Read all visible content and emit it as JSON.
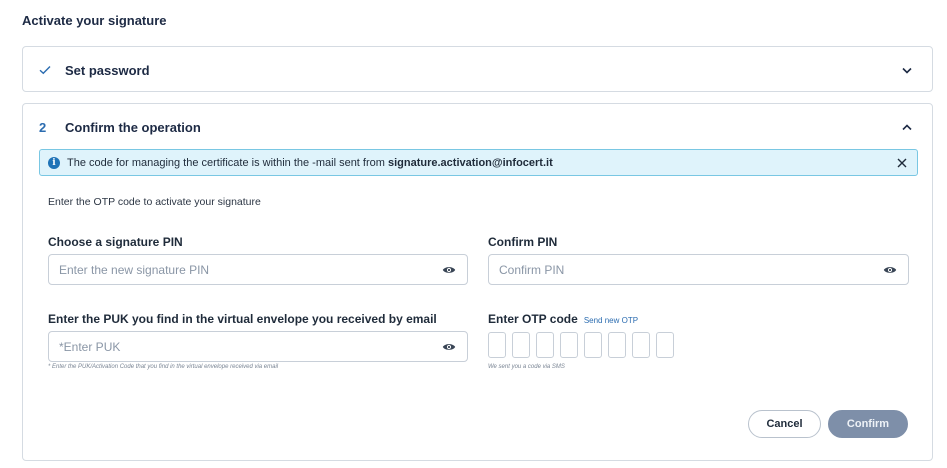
{
  "page_title": "Activate your signature",
  "step1": {
    "title": "Set password",
    "status_icon": "check-icon",
    "toggle_icon": "chevron-down-icon"
  },
  "step2": {
    "number": "2",
    "title": "Confirm the operation",
    "toggle_icon": "chevron-up-icon",
    "alert": {
      "text": "The code for managing the certificate is within the -mail sent from ",
      "email": "signature.activation@infocert.it",
      "icon": "info-icon"
    },
    "intro": "Enter the OTP code to activate your signature",
    "pin": {
      "label": "Choose a signature PIN",
      "placeholder": "Enter the new signature PIN",
      "value": ""
    },
    "confirm_pin": {
      "label": "Confirm PIN",
      "placeholder": "Confirm PIN",
      "value": ""
    },
    "puk": {
      "label": "Enter the PUK you find in the virtual envelope you received by email",
      "placeholder": "*Enter PUK",
      "value": "",
      "hint": "* Enter the PUK/Activation Code that you find in the virtual envelope received via email"
    },
    "otp": {
      "label": "Enter OTP code",
      "resend_link": "Send new OTP",
      "box_count": 8,
      "hint": "We sent you a code via SMS"
    },
    "cancel_label": "Cancel",
    "confirm_label": "Confirm"
  },
  "colors": {
    "accent": "#2b6cb0",
    "alert_bg": "#dff3fb",
    "alert_border": "#79c7e3",
    "confirm_disabled": "#7e8fa9"
  }
}
